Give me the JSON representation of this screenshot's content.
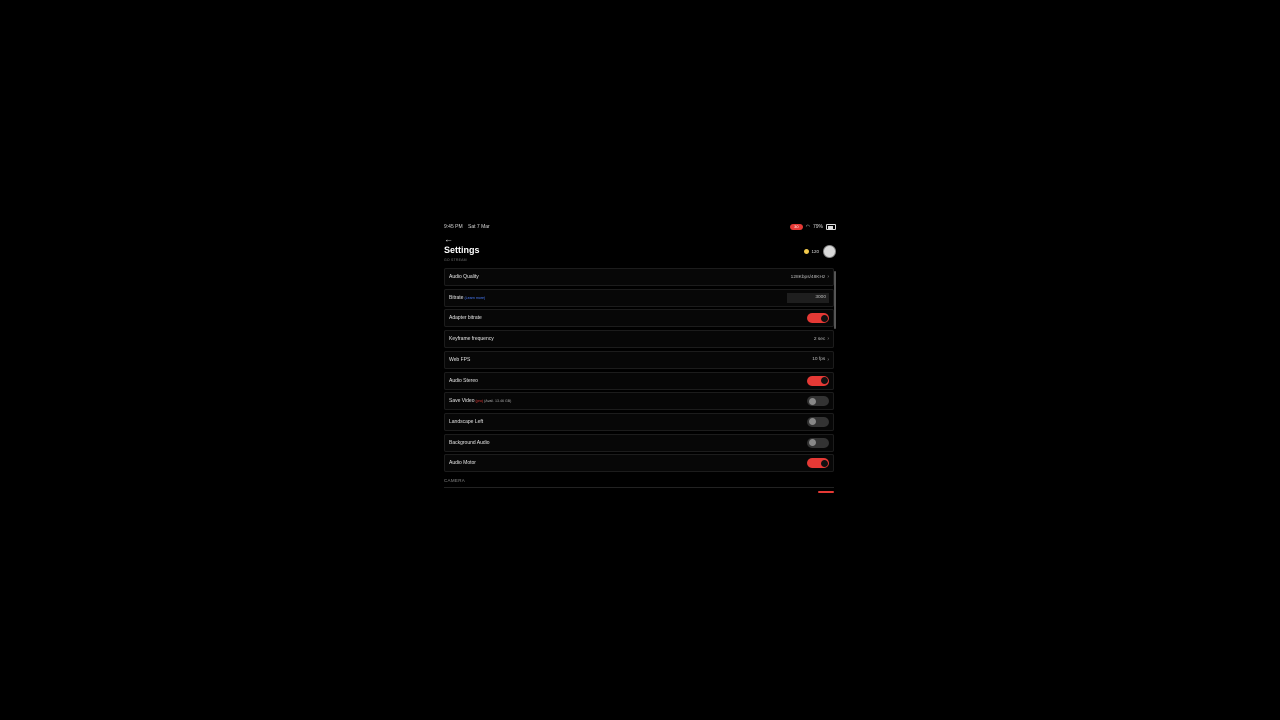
{
  "status": {
    "time": "9:45 PM",
    "date": "Sat 7 Mar",
    "rec": "30",
    "battery": "79%"
  },
  "header": {
    "title": "Settings",
    "subtitle": "GO STREAM",
    "coins": "120"
  },
  "rows": [
    {
      "label": "Audio Quality",
      "value": "128Kbps/48KHz"
    },
    {
      "label": "Bitrate",
      "link": "(Learn more)",
      "value": "3000"
    },
    {
      "label": "Adapter bitrate",
      "on": true
    },
    {
      "label": "Keyframe frequency",
      "value": "2 sec"
    },
    {
      "label": "Web FPS",
      "value": "10 fps"
    },
    {
      "label": "Audio Stereo",
      "on": true
    },
    {
      "label": "Save Video",
      "badge": "(pro)",
      "extra": "(Avail. 13.46 GB)",
      "on": false
    },
    {
      "label": "Landscape Left",
      "on": false
    },
    {
      "label": "Background Audio",
      "on": false
    },
    {
      "label": "Audio Motor",
      "on": true
    }
  ],
  "section": {
    "camera": "CAMERA"
  },
  "colors": {
    "accent": "#e53935",
    "link": "#4a7dff"
  }
}
